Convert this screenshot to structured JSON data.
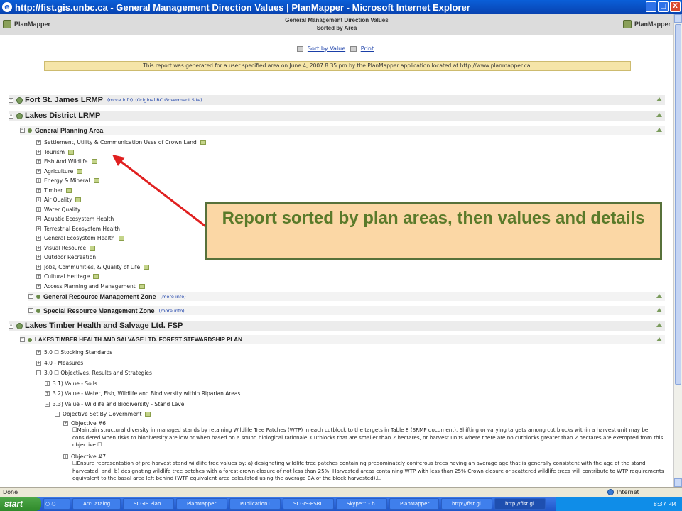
{
  "window": {
    "title": "http://fist.gis.unbc.ca - General Management Direction Values | PlanMapper - Microsoft Internet Explorer",
    "minimize": "_",
    "maximize": "□",
    "close": "X"
  },
  "header": {
    "logo_left": "PlanMapper",
    "logo_right": "PlanMapper",
    "title_line1": "General Management Direction Values",
    "title_line2": "Sorted by Area"
  },
  "links": {
    "sort_by_value": "Sort by Value",
    "print": "Print"
  },
  "notice": "This report was generated for a user specified area on June 4, 2007 8:35 pm by the PlanMapper application located at http://www.planmapper.ca.",
  "tree": {
    "section1": {
      "label": "Fort St. James LRMP",
      "more_info": "(more info)",
      "original_site": "(Original BC Goverment Site)"
    },
    "section2": {
      "label": "Lakes District LRMP",
      "general_planning_area": "General Planning Area",
      "values": [
        "Settlement, Utility & Communication Uses of Crown Land",
        "Tourism",
        "Fish And Wildlife",
        "Agriculture",
        "Energy & Mineral",
        "Timber",
        "Air Quality",
        "Water Quality",
        "Aquatic Ecosystem Health",
        "Terrestrial Ecosystem Health",
        "General Ecosystem Health",
        "Visual Resource",
        "Outdoor Recreation",
        "Jobs, Communities, & Quality of Life",
        "Cultural Heritage",
        "Access Planning and Management"
      ],
      "general_rmz": "General Resource Management Zone",
      "special_rmz": "Special Resource Management Zone",
      "more_info": "(more info)"
    },
    "section3": {
      "label": "Lakes Timber Health and Salvage Ltd. FSP",
      "plan": "LAKES TIMBER HEALTH AND SALVAGE LTD. FOREST STEWARDSHIP PLAN",
      "items": [
        "5.0 ☐ Stocking Standards",
        "4.0 - Measures",
        "3.0 ☐ Objectives, Results and Strategies"
      ],
      "subitems": [
        "3.1) Value - Soils",
        "3.2) Value - Water, Fish, Wildlife and Biodiversity within Riparian Areas",
        "3.3) Value - Wildlife and Biodiversity - Stand Level"
      ],
      "objective_set": "Objective Set By Government",
      "objective6_title": "Objective #6",
      "objective6_text": "☐Maintain structural diversity in managed stands by retaining Wildlife Tree Patches (WTP) in each cutblock to the targets in Table 8 (SRMP document). Shifting or varying targets among cut blocks within a harvest unit may be considered when risks to biodiversity are low or when based on a sound biological rationale. Cutblocks that are smaller than 2 hectares, or harvest units where there are no cutblocks greater than 2 hectares are exempted from this objective.☐",
      "objective7_title": "Objective #7",
      "objective7_text": "☐Ensure representation of pre-harvest stand wildlife tree values by: a) designating wildlife tree patches containing predominately coniferous trees having an average age that is generally consistent with the age of the stand harvested, and; b) designating wildlife tree patches with a forest crown closure of not less than 25%. Harvested areas containing WTP with less than 25% Crown closure or scattered wildlife trees will contribute to WTP requirements equivalent to the basal area left behind (WTP equivalent area calculated using the average BA of the block harvested).☐"
    }
  },
  "callout": {
    "text": "Report sorted by plan areas, then values and details"
  },
  "status": {
    "left": "Done",
    "zone": "Internet"
  },
  "taskbar": {
    "start": "start",
    "tasks": [
      "ArcCatalog ...",
      "SCGIS Plan...",
      "PlanMapper...",
      "Publication1...",
      "SCGIS-ESRI...",
      "Skype™ - b...",
      "PlanMapper...",
      "http://fist.gi...",
      "http://fist.gi..."
    ],
    "clock": "8:37 PM"
  },
  "colors": {
    "titlebar": "#0842b0",
    "callout_fill": "#fbd7a5",
    "callout_border": "#57713a",
    "callout_text": "#5a7a2a",
    "arrow": "#e02020"
  }
}
